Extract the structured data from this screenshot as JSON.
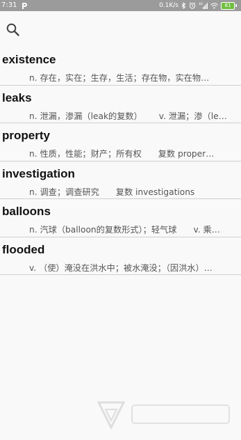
{
  "status_bar": {
    "time": "7:31",
    "app_icon": "p-logo-icon",
    "network_speed": "0.1K/s",
    "signal_label": "4G",
    "battery_level": "81",
    "icons": [
      "bluetooth-icon",
      "alarm-icon",
      "signal-icon",
      "wifi-icon",
      "battery-icon"
    ]
  },
  "search": {
    "icon": "search-icon"
  },
  "words": [
    {
      "word": "existence",
      "definition": "n. 存在，实在；生存，生活；存在物，实在物…"
    },
    {
      "word": "leaks",
      "definition": "n. 泄漏，渗漏（leak的复数）",
      "definition_extra": "v. 泄漏；渗（lea…"
    },
    {
      "word": "property",
      "definition": "n. 性质，性能；财产；所有权",
      "definition_extra": "复数 proper…"
    },
    {
      "word": "investigation",
      "definition": "n. 调查；调查研究",
      "definition_extra": "复数 investigations"
    },
    {
      "word": "balloons",
      "definition": "n. 汽球（balloon的复数形式）；轻气球",
      "definition_extra": "v. 乘…"
    },
    {
      "word": "flooded",
      "definition": "v. （使）淹没在洪水中；被水淹没；（因洪水）…"
    }
  ],
  "colors": {
    "status_bar": "#9b9b9b",
    "background": "#f9f9f9",
    "divider": "#cfcfcf",
    "battery": "#6fbf3f"
  }
}
